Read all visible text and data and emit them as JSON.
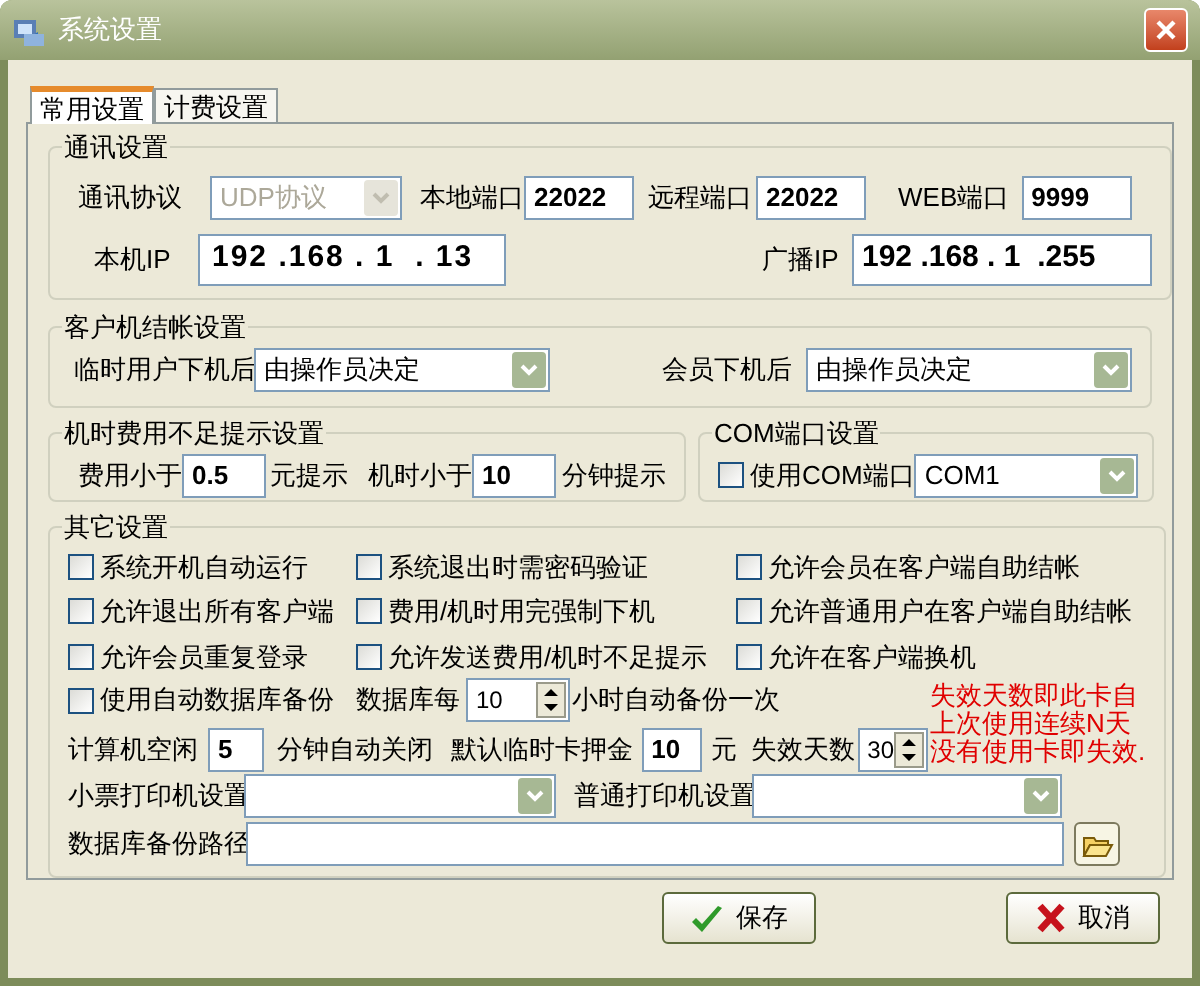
{
  "window": {
    "title": "系统设置"
  },
  "tabs": [
    {
      "label": "常用设置",
      "selected": true
    },
    {
      "label": "计费设置",
      "selected": false
    }
  ],
  "comm": {
    "title": "通讯设置",
    "protocol": {
      "label": "通讯协议",
      "value": "UDP协议",
      "disabled": true
    },
    "local_port": {
      "label": "本地端口",
      "value": "22022"
    },
    "remote_port": {
      "label": "远程端口",
      "value": "22022"
    },
    "web_port": {
      "label": "WEB端口",
      "value": "9999"
    },
    "local_ip": {
      "label": "本机IP",
      "value": "192 .168 . 1  . 13"
    },
    "broadcast_ip": {
      "label": "广播IP",
      "value": "192 .168 . 1  .255"
    }
  },
  "checkout": {
    "title": "客户机结帐设置",
    "temp_user": {
      "label": "临时用户下机后",
      "value": "由操作员决定"
    },
    "member": {
      "label": "会员下机后",
      "value": "由操作员决定"
    }
  },
  "low_balance": {
    "title": "机时费用不足提示设置",
    "fee": {
      "label": "费用小于",
      "value": "0.5",
      "unit": "元提示"
    },
    "time": {
      "label": "机时小于",
      "value": "10",
      "unit": "分钟提示"
    }
  },
  "com": {
    "title": "COM端口设置",
    "use_com": {
      "label": "使用COM端口",
      "checked": false
    },
    "port": {
      "value": "COM1"
    }
  },
  "other": {
    "title": "其它设置",
    "options": [
      {
        "label": "系统开机自动运行",
        "checked": false
      },
      {
        "label": "系统退出时需密码验证",
        "checked": false
      },
      {
        "label": "允许会员在客户端自助结帐",
        "checked": false
      },
      {
        "label": "允许退出所有客户端",
        "checked": false
      },
      {
        "label": "费用/机时用完强制下机",
        "checked": false
      },
      {
        "label": "允许普通用户在客户端自助结帐",
        "checked": false
      },
      {
        "label": "允许会员重复登录",
        "checked": false
      },
      {
        "label": "允许发送费用/机时不足提示",
        "checked": false
      },
      {
        "label": "允许在客户端换机",
        "checked": false
      }
    ],
    "backup": {
      "label": "使用自动数据库备份",
      "checked": false,
      "every": "数据库每",
      "hours": "10",
      "suffix": "小时自动备份一次"
    },
    "idle": {
      "label": "计算机空闲",
      "value": "5",
      "unit": "分钟自动关闭"
    },
    "deposit": {
      "label": "默认临时卡押金",
      "value": "10",
      "unit": "元"
    },
    "expire": {
      "label": "失效天数",
      "value": "30"
    },
    "note": [
      "失效天数即此卡自",
      "上次使用连续N天",
      "没有使用卡即失效."
    ],
    "receipt_printer": {
      "label": "小票打印机设置"
    },
    "normal_printer": {
      "label": "普通打印机设置"
    },
    "backup_path": {
      "label": "数据库备份路径"
    }
  },
  "buttons": [
    {
      "label": "保存",
      "kind": "save"
    },
    {
      "label": "取消",
      "kind": "cancel"
    }
  ]
}
